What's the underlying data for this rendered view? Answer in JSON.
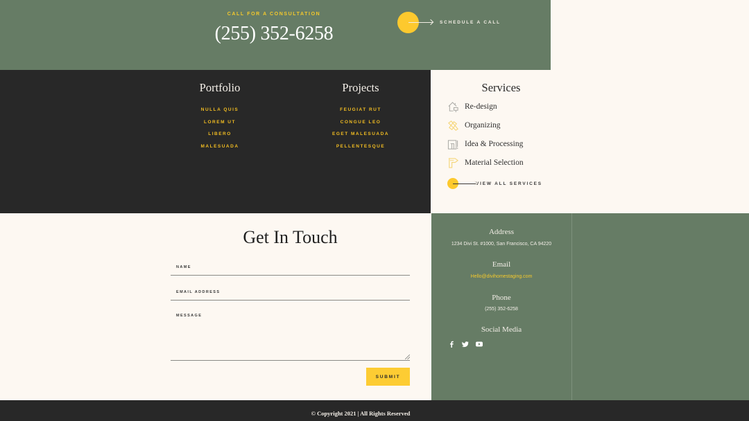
{
  "cta": {
    "eyebrow": "CALL FOR A CONSULTATION",
    "phone": "(255) 352-6258",
    "schedule_label": "SCHEDULE A CALL"
  },
  "menus": [
    {
      "title": "Portfolio",
      "links": [
        "NULLA QUIS",
        "LOREM UT",
        "LIBERO",
        "MALESUADA"
      ]
    },
    {
      "title": "Projects",
      "links": [
        "FEUGIAT RUT",
        "CONGUE LEO",
        "EGET MALESUADA",
        "PELLENTESQUE"
      ]
    }
  ],
  "services": {
    "title": "Services",
    "items": [
      {
        "label": "Re-design",
        "icon": "house-paint-icon"
      },
      {
        "label": "Organizing",
        "icon": "tools-icon"
      },
      {
        "label": "Idea & Processing",
        "icon": "blueprint-icon"
      },
      {
        "label": "Material Selection",
        "icon": "drill-icon"
      }
    ],
    "view_all_label": "VIEW ALL SERVICES"
  },
  "contact_form": {
    "title": "Get In Touch",
    "name_placeholder": "NAME",
    "email_placeholder": "EMAIL ADDRESS",
    "message_placeholder": "MESSAGE",
    "name_value": "",
    "email_value": "",
    "message_value": "",
    "submit_label": "SUBMIT"
  },
  "contact_info": {
    "address_heading": "Address",
    "address": "1234 Divi St. #1000, San Francisco, CA 94220",
    "email_heading": "Email",
    "email": "Hello@divihomestaging.com",
    "phone_heading": "Phone",
    "phone": "(255) 352-6258",
    "social_heading": "Social Media",
    "social": [
      "facebook-icon",
      "twitter-icon",
      "youtube-icon"
    ]
  },
  "footer": {
    "copyright": "© Copyright 2021 | All Rights Reserved"
  },
  "colors": {
    "green": "#667c65",
    "dark": "#282828",
    "cream": "#fdf8f2",
    "accent_yellow": "#fdc92e",
    "link_gold": "#f2bd22"
  }
}
